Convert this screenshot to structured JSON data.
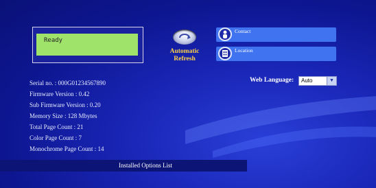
{
  "status": {
    "lcd_text": "Ready"
  },
  "refresh": {
    "icon": "refresh-icon",
    "label_line1": "Automatic",
    "label_line2": "Refresh"
  },
  "links": [
    {
      "label": "Contact",
      "icon": "contact-person-icon"
    },
    {
      "label": "Location",
      "icon": "location-building-icon"
    }
  ],
  "device_info": [
    "Serial no. : 000G01234567890",
    "Firmware Version : 0.42",
    "Sub Firmware Version : 0.20",
    "Memory Size : 128 Mbytes",
    "Total Page Count : 21",
    "Color Page Count : 7",
    "Monochrome Page Count : 14"
  ],
  "language": {
    "label": "Web Language:",
    "selected": "Auto"
  },
  "options": {
    "label": "Installed Options List"
  },
  "colors": {
    "background": "#0d1690",
    "link_bar": "#3f73f0",
    "lcd": "#9fe36a",
    "accent": "#ffd24a"
  }
}
